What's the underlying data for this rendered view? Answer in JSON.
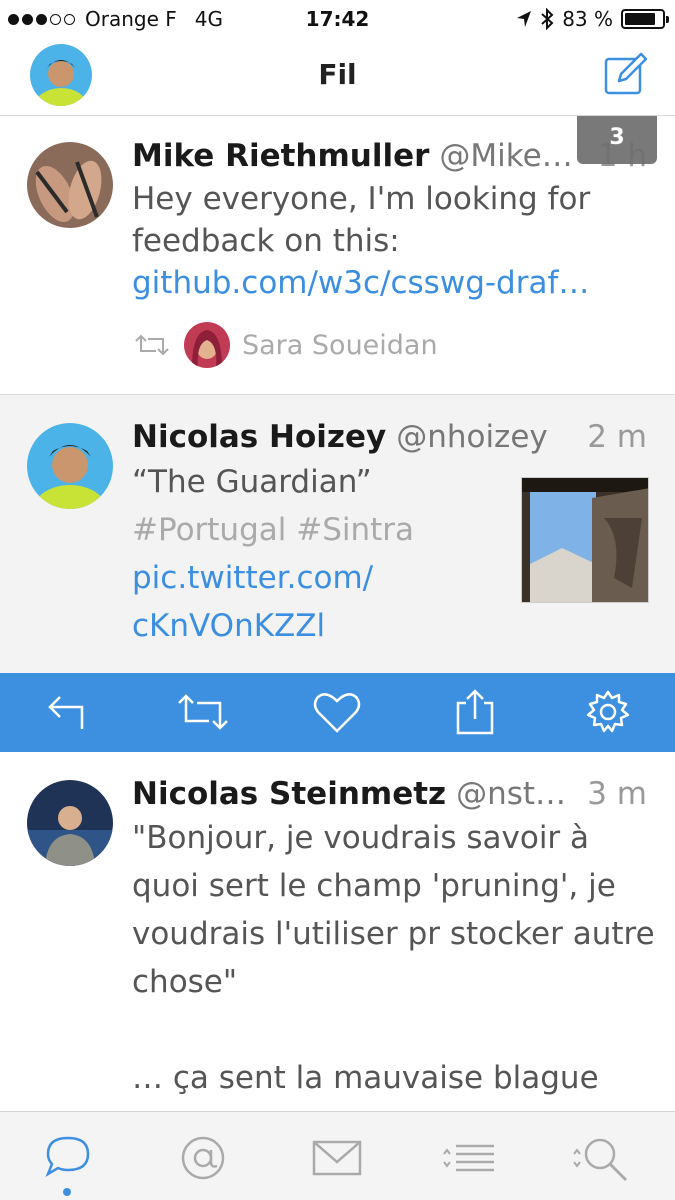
{
  "status_bar": {
    "carrier": "Orange F",
    "network": "4G",
    "time": "17:42",
    "battery": "83 %",
    "battery_level": 0.83
  },
  "navbar": {
    "title": "Fil",
    "avatar_icon": "user-avatar",
    "compose_icon": "compose-icon"
  },
  "new_tweets_badge": "3",
  "tweets": [
    {
      "name": "Mike Riethmuller",
      "handle": "@MikeRiet…",
      "time": "1 h",
      "text": "Hey everyone, I'm looking for feedback on this: ",
      "link": "github.com/w3c/csswg-draf…",
      "retweeted_by": "Sara Soueidan"
    },
    {
      "name": "Nicolas Hoizey",
      "handle": "@nhoizey",
      "time": "2 m",
      "text": "“The Guardian”",
      "hashtags": "#Portugal #Sintra",
      "link": "pic.twitter.com/cKnVOnKZZl"
    },
    {
      "name": "Nicolas Steinmetz",
      "handle": "@nstein…",
      "time": "3 m",
      "text_lines": [
        "\"Bonjour, je voudrais savoir à",
        "quoi sert le champ 'pruning', je",
        "voudrais l'utiliser pr stocker autre",
        "chose\"",
        "",
        "… ça sent la mauvaise blague"
      ]
    }
  ],
  "actions": [
    "reply-icon",
    "retweet-icon",
    "like-icon",
    "share-icon",
    "settings-icon"
  ],
  "tabs": [
    "timeline-icon",
    "mentions-icon",
    "messages-icon",
    "lists-icon",
    "search-icon"
  ],
  "colors": {
    "accent": "#3d8fe0",
    "link": "#3b8ee0",
    "selected_bg": "#f3f3f3"
  }
}
